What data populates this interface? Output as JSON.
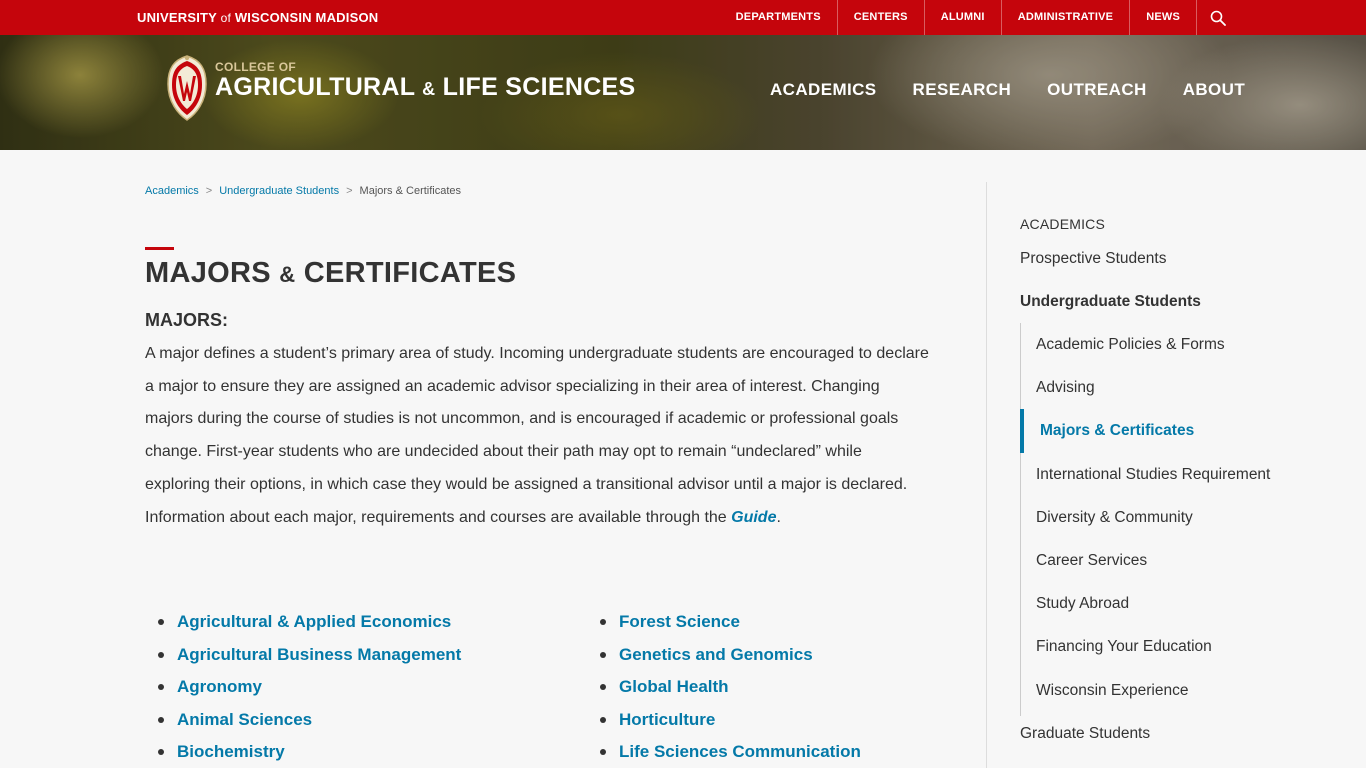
{
  "topbar": {
    "uw_part1": "UNIVERSITY ",
    "uw_of": "of",
    "uw_part2": " WISCONSIN MADISON",
    "links": [
      "DEPARTMENTS",
      "CENTERS",
      "ALUMNI",
      "ADMINISTRATIVE",
      "NEWS"
    ],
    "search_icon": "search-icon"
  },
  "banner": {
    "college_small": "COLLEGE OF",
    "college_part1": "AGRICULTURAL ",
    "college_amp": "&",
    "college_part2": " LIFE SCIENCES",
    "nav": [
      "ACADEMICS",
      "RESEARCH",
      "OUTREACH",
      "ABOUT"
    ]
  },
  "breadcrumb": {
    "items": [
      "Academics",
      "Undergraduate Students"
    ],
    "current": "Majors & Certificates"
  },
  "main": {
    "title_part1": "MAJORS ",
    "title_amp": "&",
    "title_part2": " CERTIFICATES",
    "section_heading": "MAJORS:",
    "intro_text": "A major defines a student’s primary area of study. Incoming undergraduate students are encouraged to declare a major to ensure they are assigned an academic advisor specializing in their area of interest. Changing majors during the course of studies is not uncommon, and is encouraged if academic or professional goals change. First-year students who are undecided about their path may opt to remain “undeclared” while exploring their options, in which case they would be assigned a transitional advisor until a major is declared.  Information about each major, requirements and courses are available through the ",
    "guide_link": "Guide",
    "intro_end": ".",
    "majors_col1": [
      "Agricultural & Applied Economics",
      "Agricultural Business Management",
      "Agronomy",
      "Animal Sciences",
      "Biochemistry"
    ],
    "majors_col2": [
      "Forest Science",
      "Genetics and Genomics",
      "Global Health",
      "Horticulture",
      "Life Sciences Communication"
    ]
  },
  "sidebar": {
    "section": "ACADEMICS",
    "prospective": "Prospective Students",
    "undergrad": "Undergraduate Students",
    "sub_items": [
      "Academic Policies & Forms",
      "Advising",
      "Majors & Certificates",
      "International Studies Requirement",
      "Diversity & Community",
      "Career Services",
      "Study Abroad",
      "Financing Your Education",
      "Wisconsin Experience"
    ],
    "graduate": "Graduate Students"
  },
  "colors": {
    "uw_red": "#c5050c",
    "link_blue": "#0479a8",
    "text": "#333333",
    "background": "#f7f7f7"
  }
}
